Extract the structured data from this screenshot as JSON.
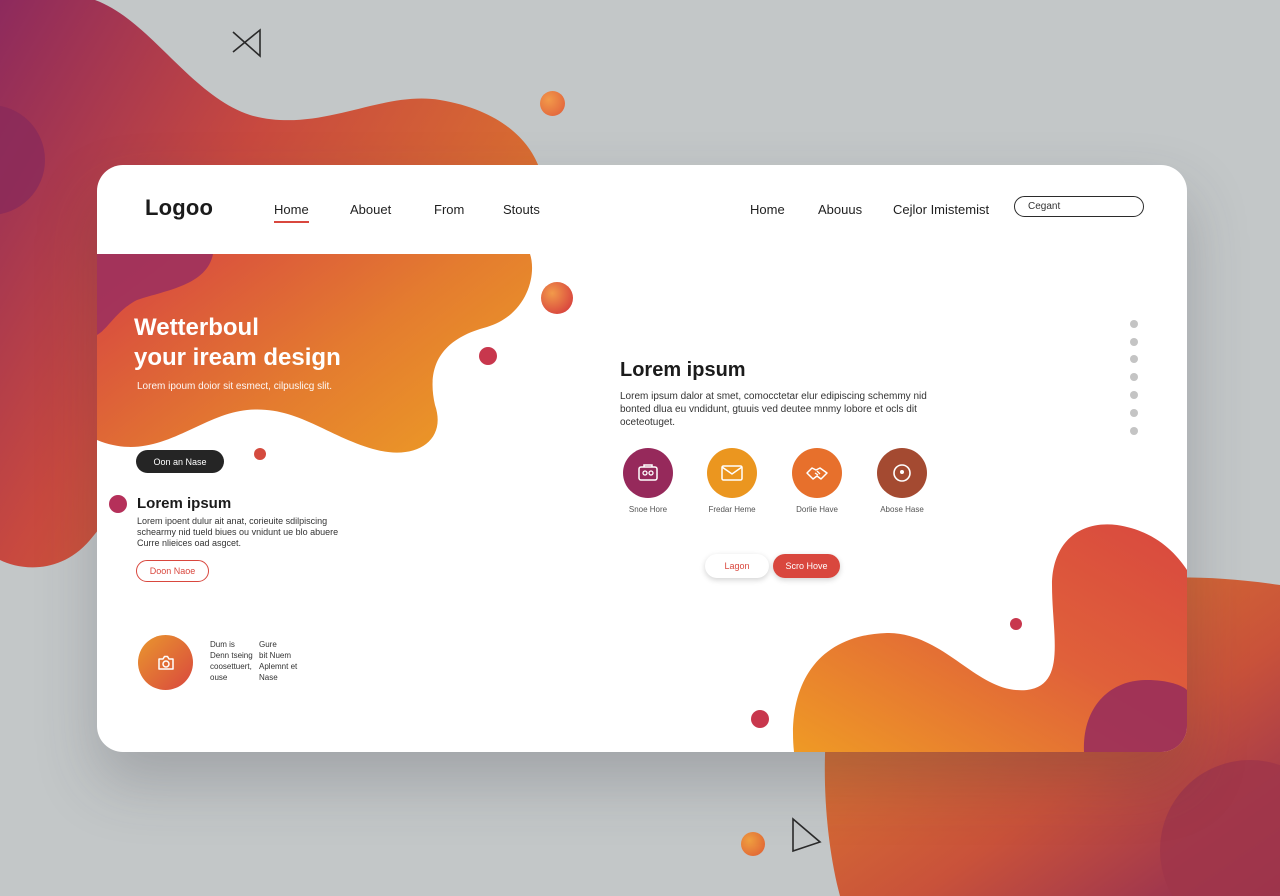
{
  "header": {
    "logo": "Logoo",
    "nav_left": [
      "Home",
      "Abouet",
      "From",
      "Stouts"
    ],
    "nav_right": [
      "Home",
      "Abouus",
      "Cejlor Imistemist"
    ],
    "search_placeholder": "Cegant"
  },
  "hero": {
    "title_line1": "Wetterboul",
    "title_line2": "your iream design",
    "subtitle": "Lorem ipoum doior sit esmect, cilpuslicg slit.",
    "button": "Oon an Nase"
  },
  "section_left": {
    "title": "Lorem ipsum",
    "text": "Lorem ipoent dulur ait anat, corieuite sdilpiscing schearmy nid tueld biues ou vnidunt ue blo abuere Curre nlieices oad asgcet.",
    "button": "Doon Naoe"
  },
  "feature": {
    "col1": [
      "Dum is",
      "Denn tseing",
      "coosettuert,",
      "ouse"
    ],
    "col2": [
      "Gure",
      "bit Nuem",
      "Aplemnt et",
      "Nase"
    ]
  },
  "main": {
    "title": "Lorem ipsum",
    "text": "Lorem ipsum dalor at smet, comocctetar elur edipiscing schemmy nid bonted dlua eu vndidunt, gtuuis ved deutee mnmy lobore et ocls dit oceteotuget."
  },
  "services": [
    {
      "label": "Snoe Hore",
      "icon": "id-card-icon",
      "color": "#96295b"
    },
    {
      "label": "Fredar Heme",
      "icon": "mail-icon",
      "color": "#eb961f"
    },
    {
      "label": "Dorlie Have",
      "icon": "handshake-icon",
      "color": "#e7702c"
    },
    {
      "label": "Abose Hase",
      "icon": "target-icon",
      "color": "#a44a31"
    }
  ],
  "actions": {
    "secondary": "Lagon",
    "primary": "Scro Hove"
  },
  "colors": {
    "accent_red": "#d9473e",
    "orange": "#e9972e",
    "magenta": "#8e2a5e",
    "background": "#c3c7c8"
  }
}
